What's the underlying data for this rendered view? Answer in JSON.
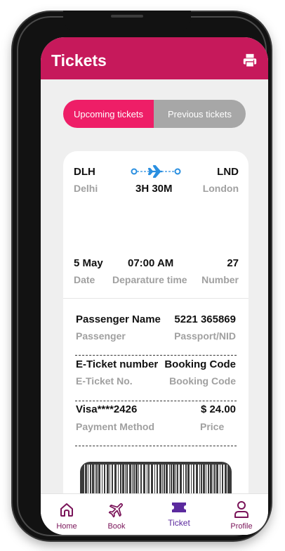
{
  "header": {
    "title": "Tickets"
  },
  "toggle": {
    "upcoming": "Upcoming tickets",
    "previous": "Previous tickets"
  },
  "flight": {
    "from_code": "DLH",
    "from_city": "Delhi",
    "to_code": "LND",
    "to_city": "London",
    "duration": "3H 30M"
  },
  "details": {
    "date_value": "5 May",
    "date_label": "Date",
    "time_value": "07:00 AM",
    "time_label": "Deparature time",
    "number_value": "27",
    "number_label": "Number"
  },
  "passenger": {
    "name_value": "Passenger Name",
    "name_label": "Passenger",
    "passport_value": "5221 365869",
    "passport_label": "Passport/NID"
  },
  "ticket": {
    "eticket_value": "E-Ticket number",
    "eticket_label": "E-Ticket No.",
    "booking_value": "Booking Code",
    "booking_label": "Booking Code"
  },
  "payment": {
    "method_value": "Visa****2426",
    "method_label": "Payment Method",
    "price_value": "$ 24.00",
    "price_label": "Price"
  },
  "nav": {
    "home": "Home",
    "book": "Book",
    "ticket": "Ticket",
    "profile": "Profile"
  },
  "colors": {
    "brand": "#c6195b",
    "accent": "#ee1e67",
    "nav": "#7a1459",
    "active_nav": "#5b2a9e"
  }
}
